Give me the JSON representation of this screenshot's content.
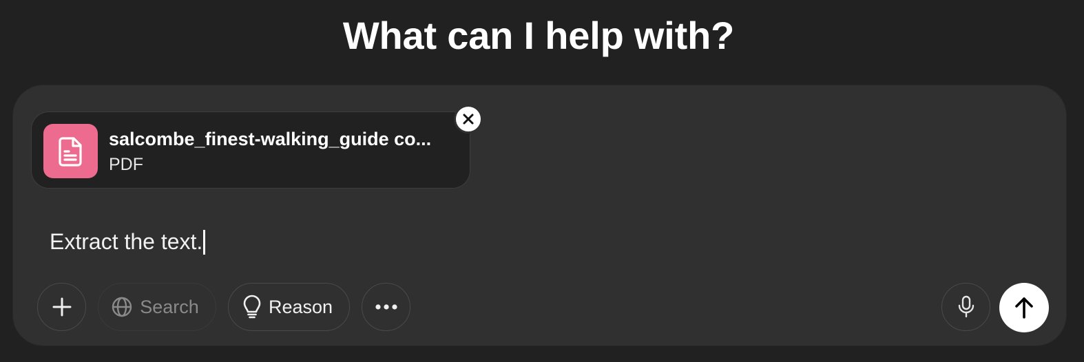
{
  "headline": "What can I help with?",
  "attachment": {
    "name": "salcombe_finest-walking_guide co...",
    "type": "PDF",
    "icon": "document-icon",
    "icon_color": "#ec6b8e"
  },
  "composer": {
    "text": "Extract the text."
  },
  "toolbar": {
    "search_label": "Search",
    "reason_label": "Reason"
  },
  "colors": {
    "background": "#212121",
    "composer": "#303030",
    "accent_file": "#ec6b8e"
  }
}
